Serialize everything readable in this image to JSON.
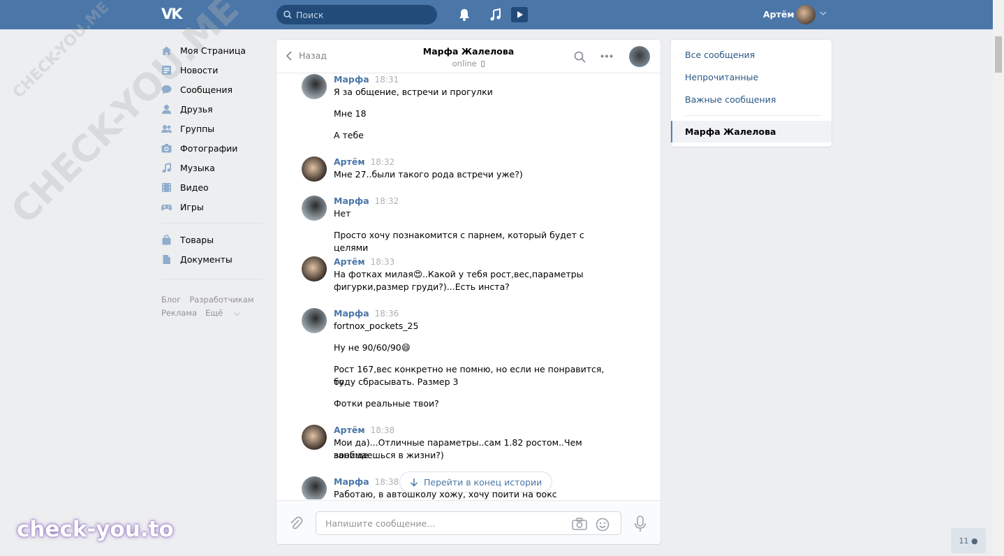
{
  "header": {
    "logo": "VK",
    "search_placeholder": "Поиск",
    "user_name": "Артём"
  },
  "nav": {
    "items": [
      {
        "label": "Моя Страница",
        "icon": "home-icon"
      },
      {
        "label": "Новости",
        "icon": "news-icon"
      },
      {
        "label": "Сообщения",
        "icon": "messages-icon"
      },
      {
        "label": "Друзья",
        "icon": "friends-icon"
      },
      {
        "label": "Группы",
        "icon": "groups-icon"
      },
      {
        "label": "Фотографии",
        "icon": "camera-icon"
      },
      {
        "label": "Музыка",
        "icon": "music-icon"
      },
      {
        "label": "Видео",
        "icon": "video-icon"
      },
      {
        "label": "Игры",
        "icon": "gamepad-icon"
      }
    ],
    "items2": [
      {
        "label": "Товары",
        "icon": "bag-icon"
      },
      {
        "label": "Документы",
        "icon": "document-icon"
      }
    ],
    "footer": [
      "Блог",
      "Разработчикам",
      "Реклама",
      "Ещё"
    ]
  },
  "chat": {
    "back_label": "Назад",
    "peer_name": "Марфа Жалелова",
    "peer_status": "online",
    "messages": [
      {
        "author": "Марфа",
        "time": "18:31",
        "lines": [
          "Я за общение, встречи и прогулки",
          "Мне 18",
          "А тебе"
        ]
      },
      {
        "author": "Артём",
        "time": "18:32",
        "lines": [
          "Мне 27..были такого рода встречи уже?)"
        ]
      },
      {
        "author": "Марфа",
        "time": "18:32",
        "lines": [
          "Нет",
          "Просто хочу познакомится с парнем, который будет с целями"
        ]
      },
      {
        "author": "Артём",
        "time": "18:33",
        "lines": [
          "На фотках милая😍..Какой у тебя рост,вес,параметры",
          "фигурки,размер груди?)...Есть инста?"
        ]
      },
      {
        "author": "Марфа",
        "time": "18:36",
        "lines": [
          "fortnox_pockets_25",
          "Ну не 90/60/90😄",
          "Рост 167,вес конкретно не помню, но если не понравится, то",
          "буду сбрасывать. Размер 3",
          "Фотки реальные твои?"
        ]
      },
      {
        "author": "Артём",
        "time": "18:38",
        "lines": [
          "Мои да)...Отличные параметры..сам 1.82 ростом..Чем вообще",
          "занимаешься в жизни?)"
        ]
      },
      {
        "author": "Марфа",
        "time": "18:38",
        "lines": [
          "Работаю, в автошколу хожу, хочу пойти на бокс"
        ]
      }
    ],
    "goto_end_label": "Перейти в конец истории",
    "composer_placeholder": "Напишите сообщение..."
  },
  "right_menu": {
    "items": [
      "Все сообщения",
      "Непрочитанные",
      "Важные сообщения"
    ],
    "active": "Марфа Жалелова"
  },
  "watermark": {
    "text": "CHECK-YOU.ME",
    "brand": "check-you.to"
  },
  "counter": "11"
}
